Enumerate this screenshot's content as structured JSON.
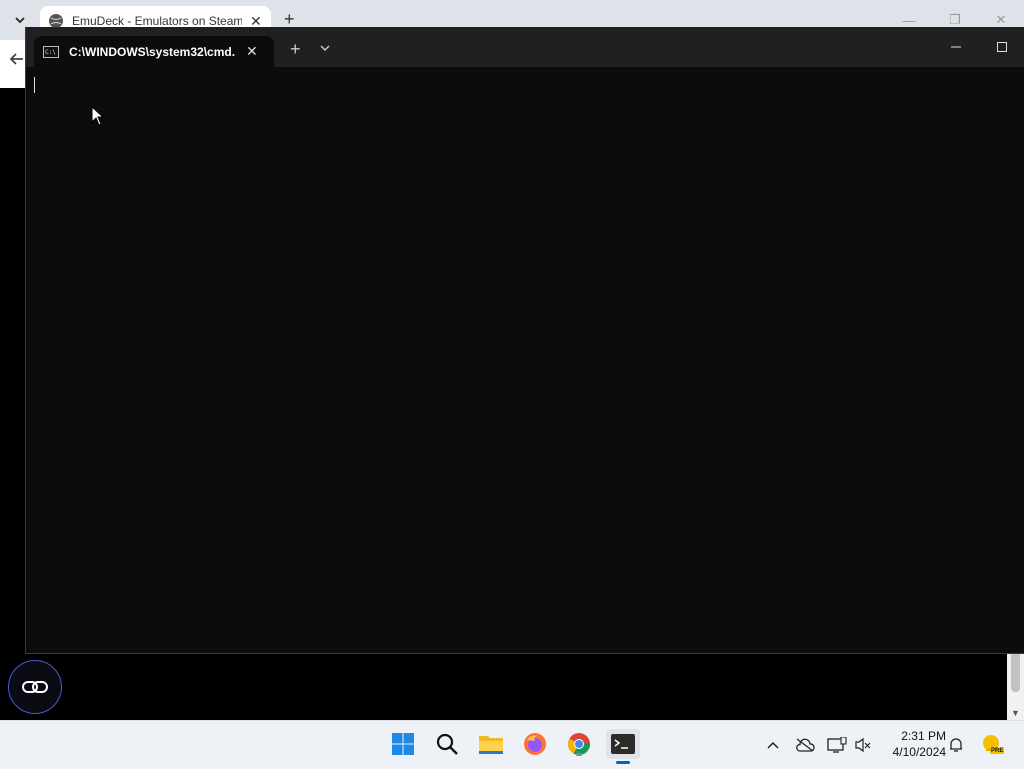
{
  "browser": {
    "tab_title": "EmuDeck - Emulators on Steam",
    "new_tab_glyph": "+",
    "tab_close_glyph": "✕"
  },
  "terminal": {
    "tab_title": "C:\\WINDOWS\\system32\\cmd.",
    "new_tab_glyph": "+",
    "tab_close_glyph": "✕",
    "dropdown_glyph": "⌄",
    "cmd_icon_text": "C:\\"
  },
  "taskbar": {
    "time": "2:31 PM",
    "date": "4/10/2024",
    "pinned": [
      "windows-start",
      "search",
      "file-explorer",
      "firefox",
      "chrome",
      "terminal"
    ],
    "badge_text": "PRE"
  },
  "colors": {
    "terminal_bg": "#0c0c0c",
    "titlebar_bg": "#202020",
    "taskbar_bg": "#eef1f6",
    "accent": "#0067c0"
  }
}
